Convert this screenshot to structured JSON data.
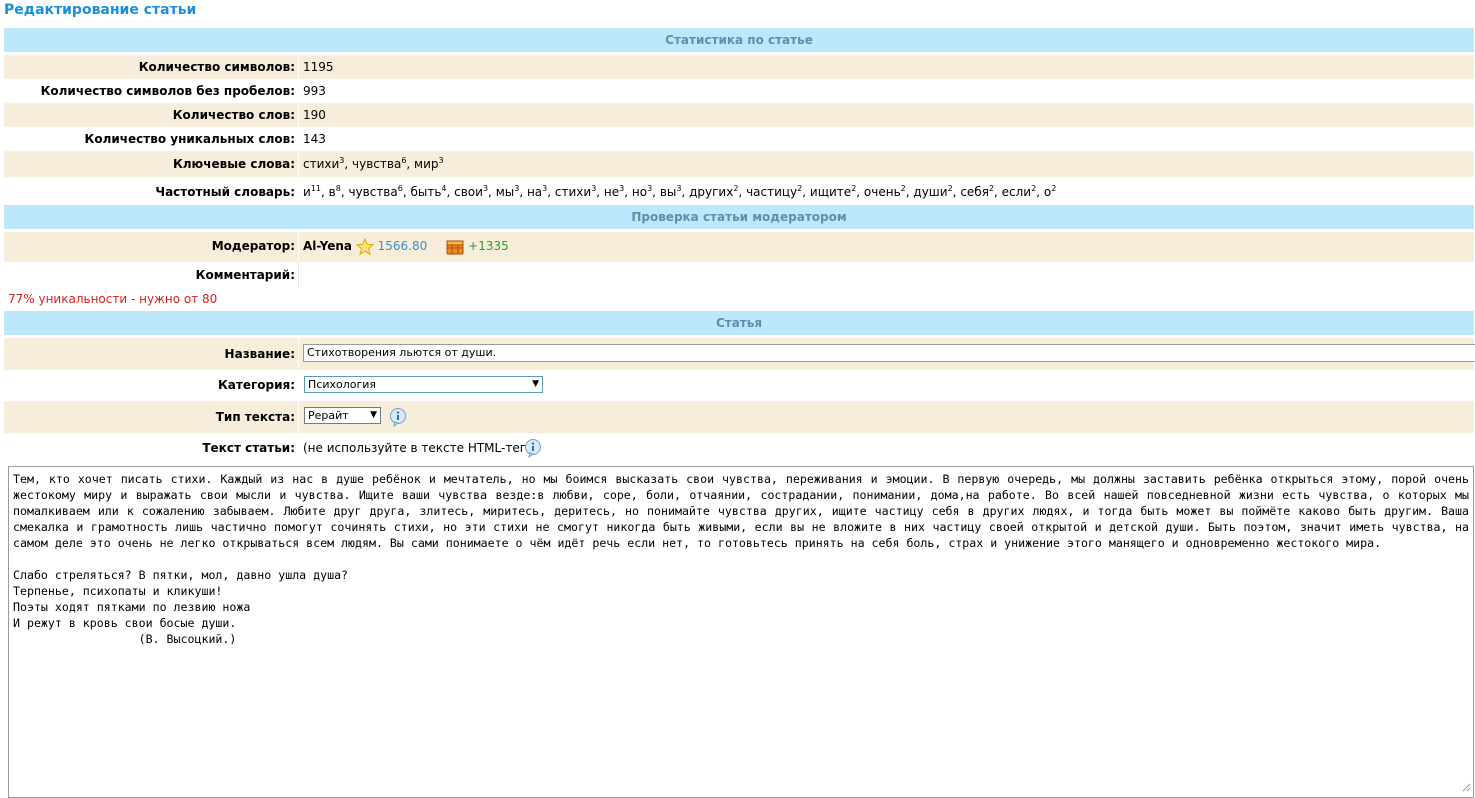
{
  "page": {
    "title": "Редактирование статьи"
  },
  "stats": {
    "header": "Статистика по статье",
    "rows": [
      {
        "label": "Количество символов:",
        "value": "1195"
      },
      {
        "label": "Количество символов без пробелов:",
        "value": "993"
      },
      {
        "label": "Количество слов:",
        "value": "190"
      },
      {
        "label": "Количество уникальных слов:",
        "value": "143"
      }
    ],
    "keywords_label": "Ключевые слова:",
    "keywords": [
      {
        "word": "стихи",
        "count": "3"
      },
      {
        "word": "чувства",
        "count": "6"
      },
      {
        "word": "мир",
        "count": "3"
      }
    ],
    "freq_label": "Частотный словарь:",
    "freq": [
      {
        "word": "и",
        "count": "11"
      },
      {
        "word": "в",
        "count": "8"
      },
      {
        "word": "чувства",
        "count": "6"
      },
      {
        "word": "быть",
        "count": "4"
      },
      {
        "word": "свои",
        "count": "3"
      },
      {
        "word": "мы",
        "count": "3"
      },
      {
        "word": "на",
        "count": "3"
      },
      {
        "word": "стихи",
        "count": "3"
      },
      {
        "word": "не",
        "count": "3"
      },
      {
        "word": "но",
        "count": "3"
      },
      {
        "word": "вы",
        "count": "3"
      },
      {
        "word": "других",
        "count": "2"
      },
      {
        "word": "частицу",
        "count": "2"
      },
      {
        "word": "ищите",
        "count": "2"
      },
      {
        "word": "очень",
        "count": "2"
      },
      {
        "word": "души",
        "count": "2"
      },
      {
        "word": "себя",
        "count": "2"
      },
      {
        "word": "если",
        "count": "2"
      },
      {
        "word": "о",
        "count": "2"
      }
    ]
  },
  "moderation": {
    "header": "Проверка статьи модератором",
    "moderator_label": "Модератор:",
    "moderator_name": "Al-Yena",
    "rating": "1566.80",
    "bonus": "+1335",
    "comment_label": "Комментарий:",
    "comment": ""
  },
  "uniqueness_notice": "77% уникальности - нужно от 80",
  "article": {
    "header": "Статья",
    "title_label": "Название:",
    "title_value": "Стихотворения льются от души.",
    "category_label": "Категория:",
    "category_value": "Психология",
    "type_label": "Тип текста:",
    "type_value": "Рерайт",
    "text_label": "Текст статьи:",
    "text_hint": "(не используйте в тексте HTML-теги)",
    "body": "Тем, кто хочет писать стихи. Каждый из нас в душе ребёнок и мечтатель, но мы боимся высказать свои чувства, переживания и эмоции. В первую очередь, мы должны заставить ребёнка открыться этому, порой очень жестокому миру и выражать свои мысли и чувства. Ищите ваши чувства везде:в любви, соре, боли, отчаянии, сострадании, понимании, дома,на работе. Во всей нашей повседневной жизни есть чувства, о которых мы помалкиваем или к сожалению забываем. Любите друг друга, злитесь, миритесь, деритесь, но понимайте чувства других, ищите частицу себя в других людях, и тогда быть может вы поймёте каково быть другим. Ваша смекалка и грамотность лишь частично помогут сочинять стихи, но эти стихи не смогут никогда быть живыми, если вы не вложите в них частицу своей открытой и детской души. Быть поэтом, значит иметь чувства, на самом деле это очень не легко открываться всем людям. Вы сами понимаете о чём идёт речь если нет, то готовьтесь принять на себя боль, страх и унижение этого манящего и одновременно жестокого мира.\n\nСлабо стреляться? В пятки, мол, давно ушла душа?\nТерпенье, психопаты и кликуши!\nПоэты ходят пятками по лезвию ножа\nИ режут в кровь свои босые души.\n                  (В. Высоцкий.)"
  },
  "colors": {
    "header_bg": "#bde7fb",
    "header_text": "#5f8fae",
    "row_beige": "#f6eedb",
    "title_blue": "#1a8fd8",
    "notice_red": "#d42020",
    "bonus_green": "#2e9b2e",
    "rating_blue": "#3b8fd0"
  }
}
